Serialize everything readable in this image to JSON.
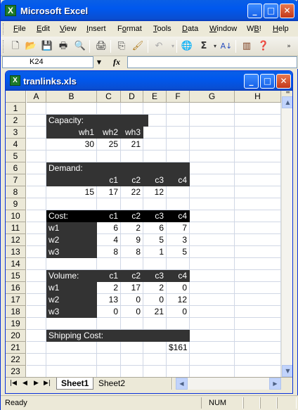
{
  "app": {
    "title": "Microsoft Excel",
    "icon": "excel-icon"
  },
  "window_controls": {
    "minimize": "_",
    "maximize": "□",
    "close": "✕"
  },
  "menu": [
    "File",
    "Edit",
    "View",
    "Insert",
    "Format",
    "Tools",
    "Data",
    "Window",
    "WB!",
    "Help"
  ],
  "menu_underline": [
    "F",
    "E",
    "V",
    "I",
    "o",
    "T",
    "D",
    "W",
    "B",
    "H"
  ],
  "toolbar": {
    "icons": [
      "new-icon",
      "open-icon",
      "save-icon",
      "permission-icon",
      "print-preview-icon",
      "print-icon",
      "copy-icon",
      "format-painter-icon",
      "undo-icon",
      "hyperlink-icon",
      "autosum-icon",
      "sort-ascending-icon",
      "chart-wizard-icon",
      "help-icon",
      "toolbar-options-icon"
    ]
  },
  "formula_bar": {
    "name_box": "K24",
    "fx": "fx",
    "formula": ""
  },
  "workbook": {
    "title": "tranlinks.xls"
  },
  "columns": [
    "A",
    "B",
    "C",
    "D",
    "E",
    "F",
    "G",
    "H"
  ],
  "rows": [
    "1",
    "2",
    "3",
    "4",
    "5",
    "6",
    "7",
    "8",
    "9",
    "10",
    "11",
    "12",
    "13",
    "14",
    "15",
    "16",
    "17",
    "18",
    "19",
    "20",
    "21",
    "22",
    "23"
  ],
  "sheet": {
    "capacity": {
      "label": "Capacity:",
      "headers": [
        "wh1",
        "wh2",
        "wh3"
      ],
      "values": [
        "30",
        "25",
        "21"
      ]
    },
    "demand": {
      "label": "Demand:",
      "headers": [
        "c1",
        "c2",
        "c3",
        "c4"
      ],
      "values": [
        "15",
        "17",
        "22",
        "12"
      ]
    },
    "cost": {
      "label": "Cost:",
      "headers": [
        "c1",
        "c2",
        "c3",
        "c4"
      ],
      "rows": [
        {
          "name": "w1",
          "values": [
            "6",
            "2",
            "6",
            "7"
          ]
        },
        {
          "name": "w2",
          "values": [
            "4",
            "9",
            "5",
            "3"
          ]
        },
        {
          "name": "w3",
          "values": [
            "8",
            "8",
            "1",
            "5"
          ]
        }
      ]
    },
    "volume": {
      "label": "Volume:",
      "headers": [
        "c1",
        "c2",
        "c3",
        "c4"
      ],
      "rows": [
        {
          "name": "w1",
          "values": [
            "2",
            "17",
            "2",
            "0"
          ]
        },
        {
          "name": "w2",
          "values": [
            "13",
            "0",
            "0",
            "12"
          ]
        },
        {
          "name": "w3",
          "values": [
            "0",
            "0",
            "21",
            "0"
          ]
        }
      ]
    },
    "shipping": {
      "label": "Shipping Cost:",
      "value": "$161"
    }
  },
  "sheet_tabs": [
    "Sheet1",
    "Sheet2"
  ],
  "active_tab": "Sheet1",
  "status": {
    "ready": "Ready",
    "num": "NUM"
  },
  "colors": {
    "dark_cell": "#333333",
    "black_cell": "#000000",
    "title_blue": "#0058ee"
  }
}
